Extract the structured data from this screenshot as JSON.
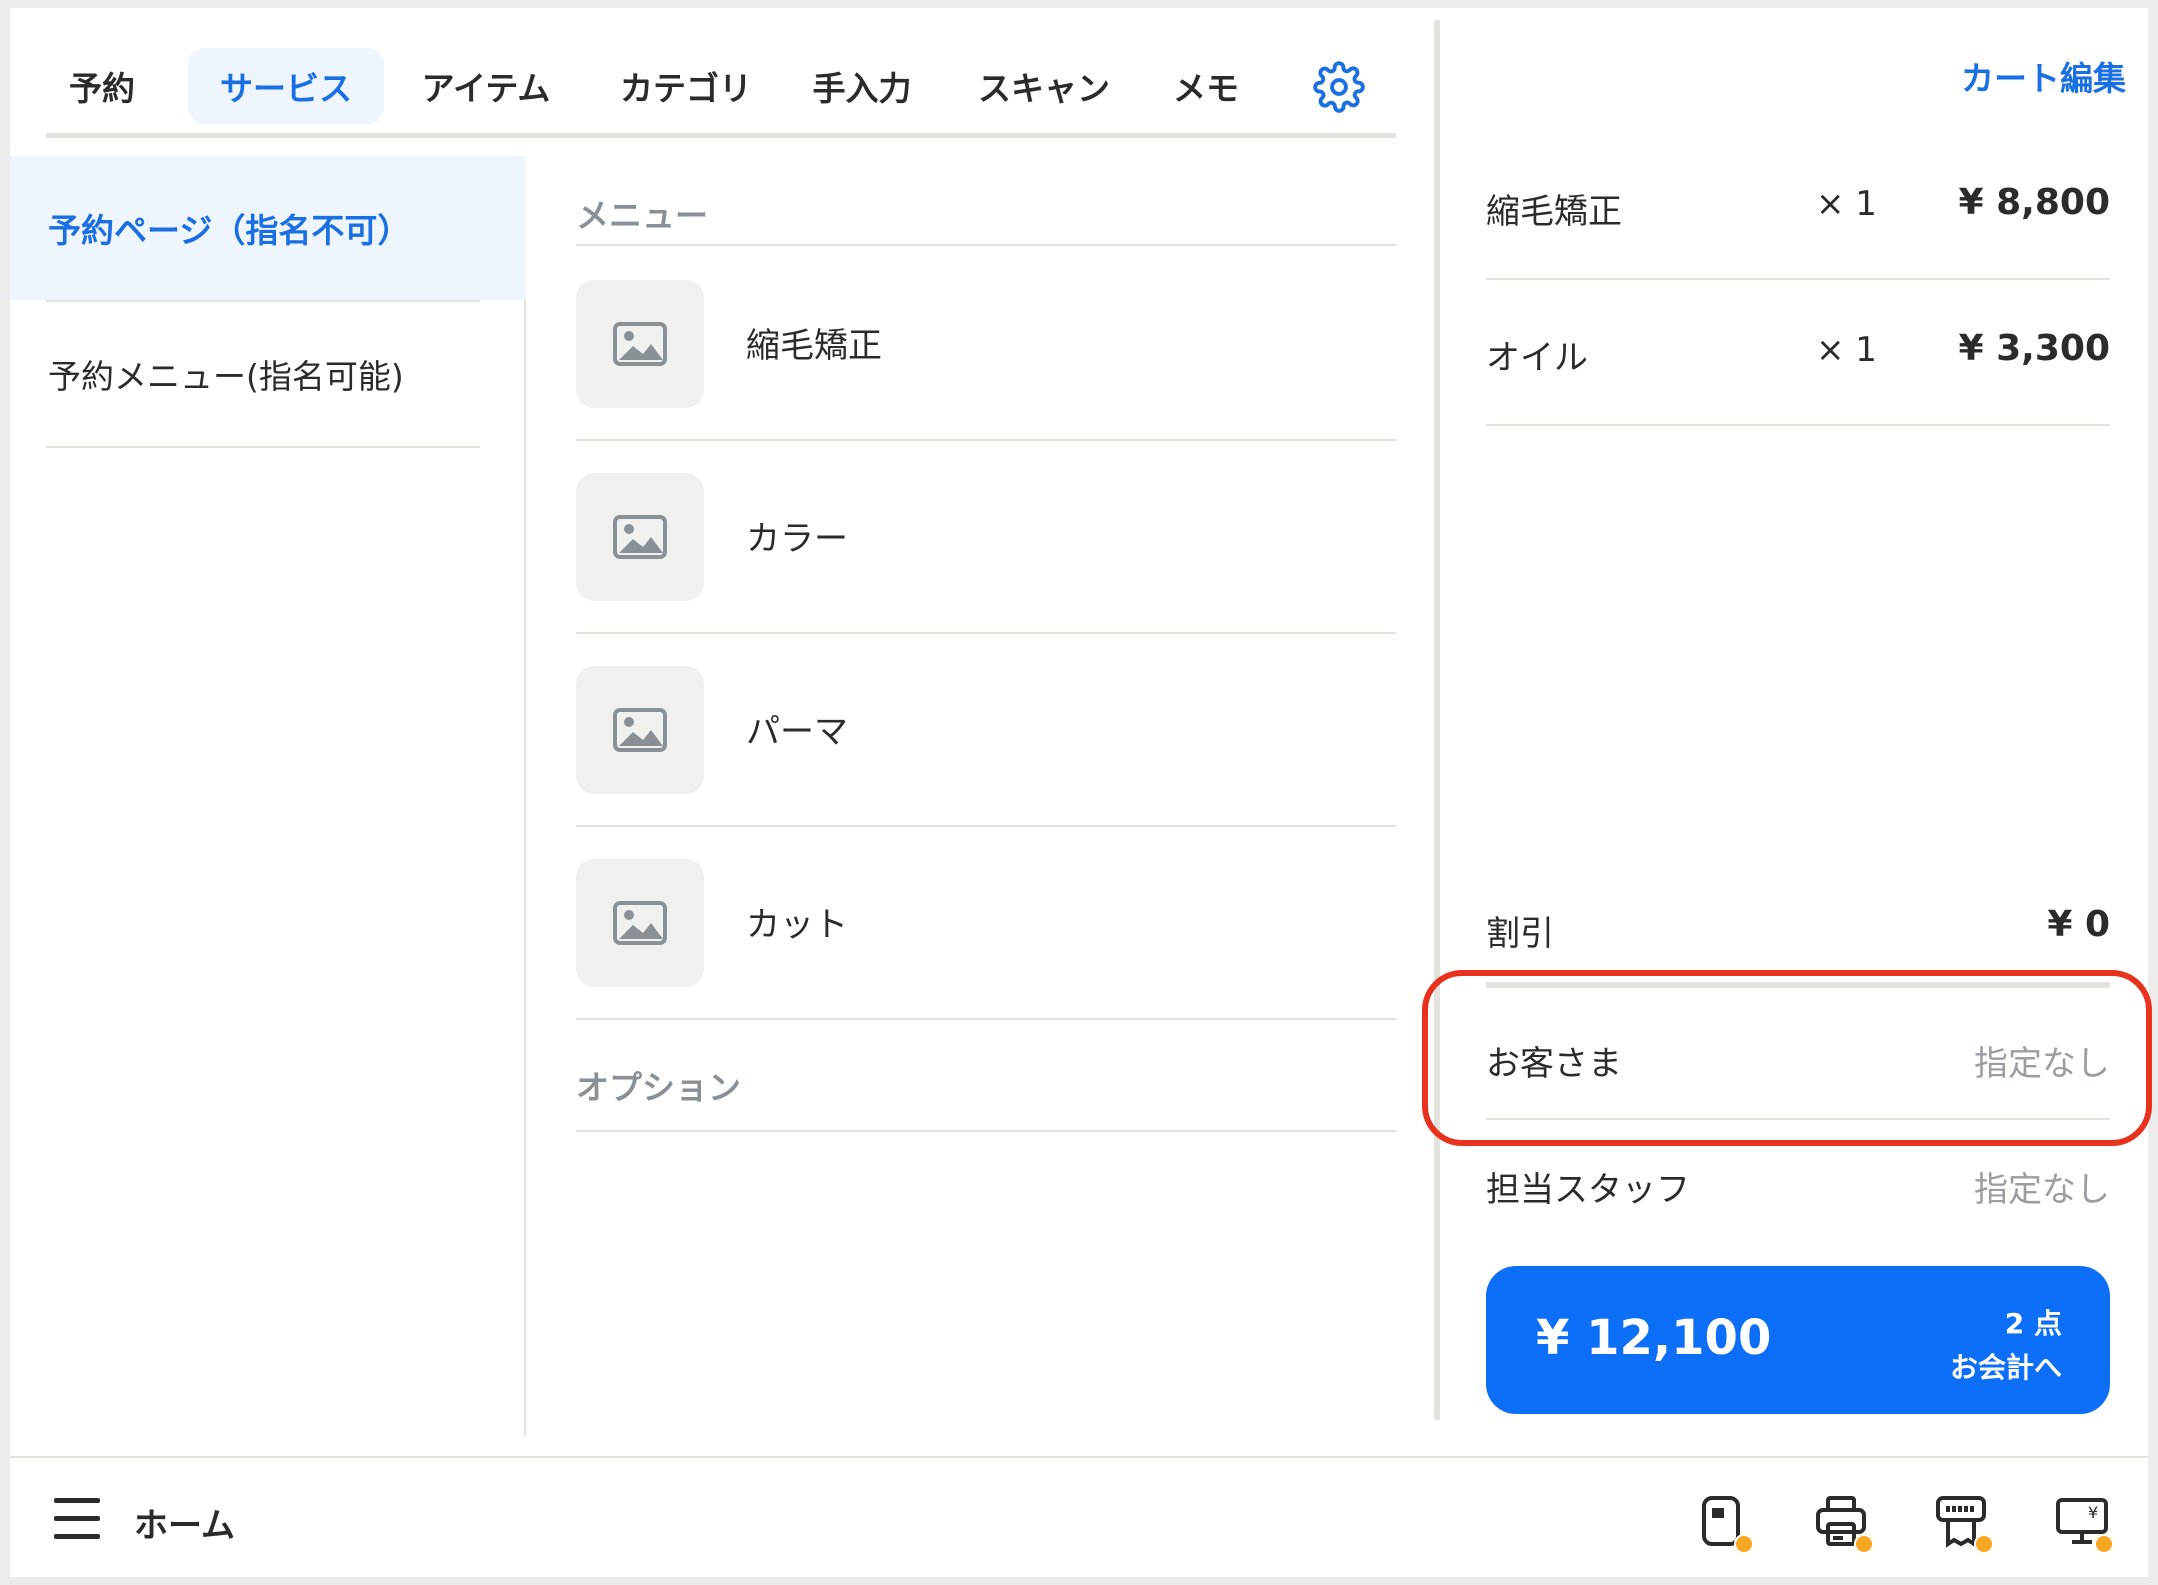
{
  "tabs": [
    {
      "label": "予約"
    },
    {
      "label": "サービス"
    },
    {
      "label": "アイテム"
    },
    {
      "label": "カテゴリ"
    },
    {
      "label": "手入力"
    },
    {
      "label": "スキャン"
    },
    {
      "label": "メモ"
    }
  ],
  "active_tab": "サービス",
  "categories": [
    {
      "label": "予約ページ（指名不可）"
    },
    {
      "label": "予約メニュー(指名可能)"
    }
  ],
  "menu": {
    "section_menu": "メニュー",
    "items": [
      {
        "label": "縮毛矯正"
      },
      {
        "label": "カラー"
      },
      {
        "label": "パーマ"
      },
      {
        "label": "カット"
      }
    ],
    "section_option": "オプション"
  },
  "cart": {
    "edit_label": "カート編集",
    "items": [
      {
        "name": "縮毛矯正",
        "qty": "× 1",
        "price": "¥ 8,800"
      },
      {
        "name": "オイル",
        "qty": "× 1",
        "price": "¥ 3,300"
      }
    ],
    "discount_label": "割引",
    "discount_value": "¥ 0",
    "customer_label": "お客さま",
    "customer_value": "指定なし",
    "staff_label": "担当スタッフ",
    "staff_value": "指定なし",
    "checkout_total": "¥ 12,100",
    "checkout_count": "2 点",
    "checkout_label": "お会計へ"
  },
  "bottom": {
    "home_label": "ホーム"
  },
  "colors": {
    "accent": "#1a6fe3",
    "checkout": "#0d6ff7",
    "highlight": "#e8321e",
    "badge": "#f6a623"
  }
}
